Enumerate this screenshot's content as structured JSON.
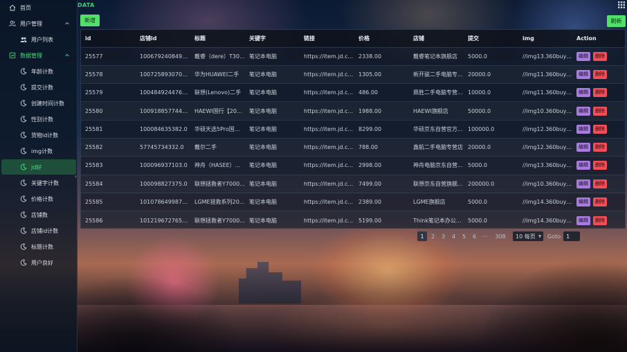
{
  "sidebar": {
    "items": [
      {
        "label": "首页",
        "icon": "home-icon"
      },
      {
        "label": "用户管理",
        "icon": "user-group-icon"
      },
      {
        "label": "用户列表",
        "icon": "users-icon"
      },
      {
        "label": "数据管理",
        "icon": "data-icon"
      },
      {
        "label": "年龄计数",
        "icon": "moon-icon"
      },
      {
        "label": "提交计数",
        "icon": "moon-icon"
      },
      {
        "label": "创建时间计数",
        "icon": "moon-icon"
      },
      {
        "label": "性别计数",
        "icon": "moon-icon"
      },
      {
        "label": "货物id计数",
        "icon": "moon-icon"
      },
      {
        "label": "img计数",
        "icon": "moon-icon"
      },
      {
        "label": "jd好",
        "icon": "moon-icon"
      },
      {
        "label": "关键字计数",
        "icon": "moon-icon"
      },
      {
        "label": "价格计数",
        "icon": "moon-icon"
      },
      {
        "label": "店铺数",
        "icon": "moon-icon"
      },
      {
        "label": "店铺id计数",
        "icon": "moon-icon"
      },
      {
        "label": "标题计数",
        "icon": "moon-icon"
      },
      {
        "label": "用户良好",
        "icon": "moon-icon"
      }
    ],
    "active_color": "#52e08a"
  },
  "header": {
    "title": "DATA",
    "grid_icon": "grid-icon"
  },
  "toolbar": {
    "add_label": "新增",
    "refresh_label": "刷新"
  },
  "table": {
    "columns": [
      "id",
      "店铺id",
      "标题",
      "关键字",
      "链接",
      "价格",
      "店铺",
      "提交",
      "img",
      "Action"
    ],
    "rows": [
      [
        "25577",
        "1006792408498...",
        "戴睿（dere）T30...",
        "笔记本电脑",
        "https://item.jd.c...",
        "2338.00",
        "戴睿笔记本旗舰店",
        "5000.0",
        "//img13.360buyi..."
      ],
      [
        "25578",
        "1007258930704...",
        "华为HUAWEI二手",
        "笔记本电脑",
        "https://item.jd.c...",
        "1305.00",
        "新开骏二手电脑专...",
        "20000.0",
        "//img11.360buyi..."
      ],
      [
        "25579",
        "1004849244761...",
        "联想(Lenovo)二手",
        "笔记本电脑",
        "https://item.jd.c...",
        "486.00",
        "鼎胜二手电脑专营...",
        "10000.0",
        "//img11.360buyi..."
      ],
      [
        "25580",
        "1009188577448...",
        "HAEWI国行【20...",
        "笔记本电脑",
        "https://item.jd.c...",
        "1988.00",
        "HAEWI旗舰店",
        "50000.0",
        "//img10.360buyi..."
      ],
      [
        "25581",
        "100084635382.0",
        "华硕天选5Pro国...",
        "笔记本电脑",
        "https://item.jd.c...",
        "8299.00",
        "华硕京东自营官方...",
        "100000.0",
        "//img12.360buyi..."
      ],
      [
        "25582",
        "57745734332.0",
        "戴尔二手",
        "笔记本电脑",
        "https://item.jd.c...",
        "788.00",
        "鑫航二手电脑专营店",
        "20000.0",
        "//img12.360buyi..."
      ],
      [
        "25583",
        "100096937103.0",
        "神舟（HASEE）...",
        "笔记本电脑",
        "https://item.jd.c...",
        "2998.00",
        "神舟电脑京东自营...",
        "5000.0",
        "//img13.360buyi..."
      ],
      [
        "25584",
        "100098827375.0",
        "联想拯救者Y7000...",
        "笔记本电脑",
        "https://item.jd.c...",
        "7499.00",
        "联想京东自营旗舰...",
        "200000.0",
        "//img10.360buyi..."
      ],
      [
        "25585",
        "1010786499873...",
        "LGME拯救系列20...",
        "笔记本电脑",
        "https://item.jd.c...",
        "2389.00",
        "LGME旗舰店",
        "5000.0",
        "//img14.360buyi..."
      ],
      [
        "25586",
        "1012196727654...",
        "联想拯救者Y7000...",
        "笔记本电脑",
        "https://item.jd.c...",
        "5199.00",
        "Think笔记本办公...",
        "5000.0",
        "//img14.360buyi..."
      ]
    ],
    "edit_label": "编辑",
    "delete_label": "删除"
  },
  "pagination": {
    "current": "1",
    "pages": [
      "1",
      "2",
      "3",
      "4",
      "5",
      "6"
    ],
    "ellipsis": "···",
    "last": "308",
    "page_size": "10 每页",
    "goto_label": "Goto",
    "goto_value": "1"
  },
  "colors": {
    "accent": "#52e06b",
    "edit": "#a87be0",
    "delete": "#ef4f59",
    "title": "#3ed07a"
  }
}
